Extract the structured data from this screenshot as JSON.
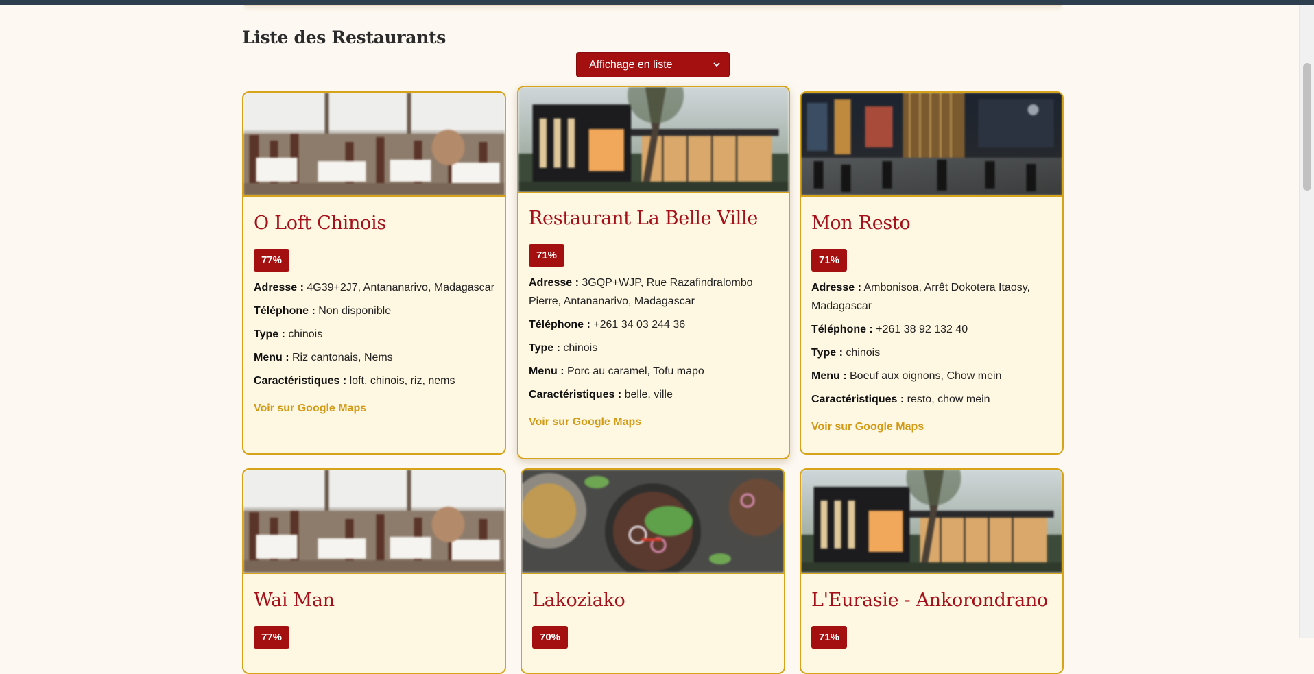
{
  "page": {
    "title": "Liste des Restaurants"
  },
  "view_select": {
    "value": "Affichage en liste"
  },
  "labels": {
    "address": "Adresse :",
    "phone": "Téléphone :",
    "type": "Type :",
    "menu": "Menu :",
    "features": "Caractéristiques :",
    "maps": "Voir sur Google Maps"
  },
  "restaurants": [
    {
      "name": "O Loft Chinois",
      "score": "77%",
      "address": "4G39+2J7, Antananarivo, Madagascar",
      "phone": "Non disponible",
      "type": "chinois",
      "menu": "Riz cantonais, Nems",
      "features": "loft, chinois, riz, nems",
      "image": "dining-room"
    },
    {
      "name": "Restaurant La Belle Ville",
      "score": "71%",
      "address": "3GQP+WJP, Rue Razafindralombo Pierre, Antananarivo, Madagascar",
      "phone": "+261 34 03 244 36",
      "type": "chinois",
      "menu": "Porc au caramel, Tofu mapo",
      "features": "belle, ville",
      "image": "modern-house"
    },
    {
      "name": "Mon Resto",
      "score": "71%",
      "address": "Ambonisoa, Arrêt Dokotera Itaosy, Madagascar",
      "phone": "+261 38 92 132 40",
      "type": "chinois",
      "menu": "Boeuf aux oignons, Chow mein",
      "features": "resto, chow mein",
      "image": "restaurant-interior"
    },
    {
      "name": "Wai Man",
      "score": "77%",
      "image": "dining-room"
    },
    {
      "name": "Lakoziako",
      "score": "70%",
      "image": "food-plates"
    },
    {
      "name": "L'Eurasie - Ankorondrano",
      "score": "71%",
      "image": "modern-house"
    }
  ],
  "colors": {
    "accent": "#a40f10",
    "border": "#d6a31a",
    "card_bg": "#fef7e2",
    "link": "#d39a16",
    "page_bg": "#fdf9f2"
  }
}
